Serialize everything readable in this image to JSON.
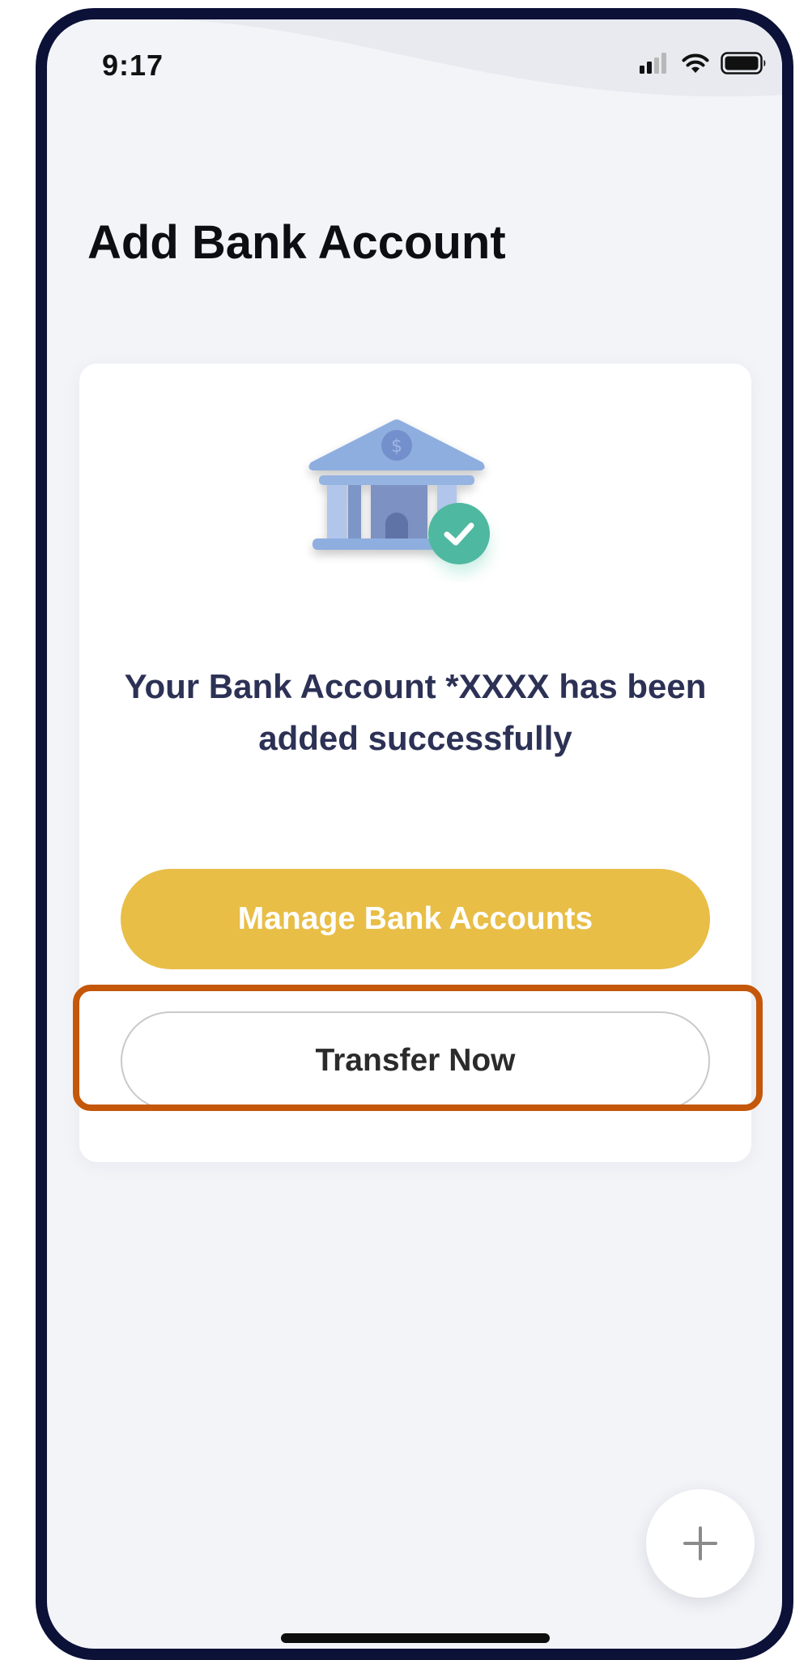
{
  "status_bar": {
    "time": "9:17",
    "icons": [
      "cellular-signal-icon",
      "wifi-icon",
      "battery-icon"
    ]
  },
  "page": {
    "title": "Add Bank Account"
  },
  "card": {
    "illustration_icon": "bank-with-checkmark-icon",
    "message": "Your Bank Account *XXXX has been added successfully",
    "primary_button_label": "Manage Bank Accounts",
    "secondary_button_label": "Transfer Now"
  },
  "fab": {
    "icon": "plus-icon"
  },
  "colors": {
    "accent_yellow": "#e8be47",
    "highlight_orange": "#c4570a",
    "success_green": "#4fb8a0",
    "bank_blue": "#8eaee0",
    "device_frame": "#0c1138"
  }
}
